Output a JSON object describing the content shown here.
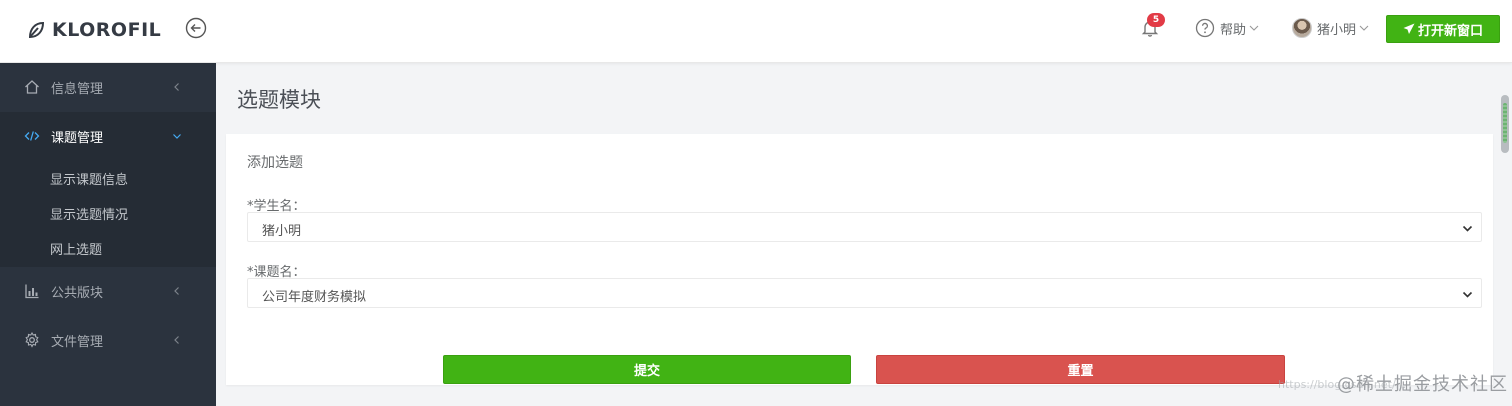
{
  "navbar": {
    "brand": "KLOROFIL",
    "notifications_count": "5",
    "help_label": "帮助",
    "user_name": "猪小明",
    "open_window_label": "打开新窗口"
  },
  "sidebar": {
    "items": [
      {
        "label": "信息管理",
        "icon": "home-icon"
      },
      {
        "label": "课题管理",
        "icon": "code-icon",
        "active": true
      },
      {
        "label": "公共版块",
        "icon": "bar-chart-icon"
      },
      {
        "label": "文件管理",
        "icon": "gear-icon"
      }
    ],
    "submenu": [
      "显示课题信息",
      "显示选题情况",
      "网上选题"
    ]
  },
  "page": {
    "title": "选题模块"
  },
  "form": {
    "title": "添加选题",
    "student_label": "*学生名：",
    "student_value": "猪小明",
    "topic_label": "*课题名：",
    "topic_value": "公司年度财务模拟",
    "submit_label": "提交",
    "reset_label": "重置"
  },
  "watermark": {
    "faint": "https://blog.csdn.net/...",
    "text": "@稀土掘金技术社区"
  },
  "colors": {
    "success": "#41b314",
    "danger": "#d9534f",
    "sidebar_bg": "#2b333e",
    "active_accent": "#45aaf2",
    "badge": "#e23b46"
  }
}
